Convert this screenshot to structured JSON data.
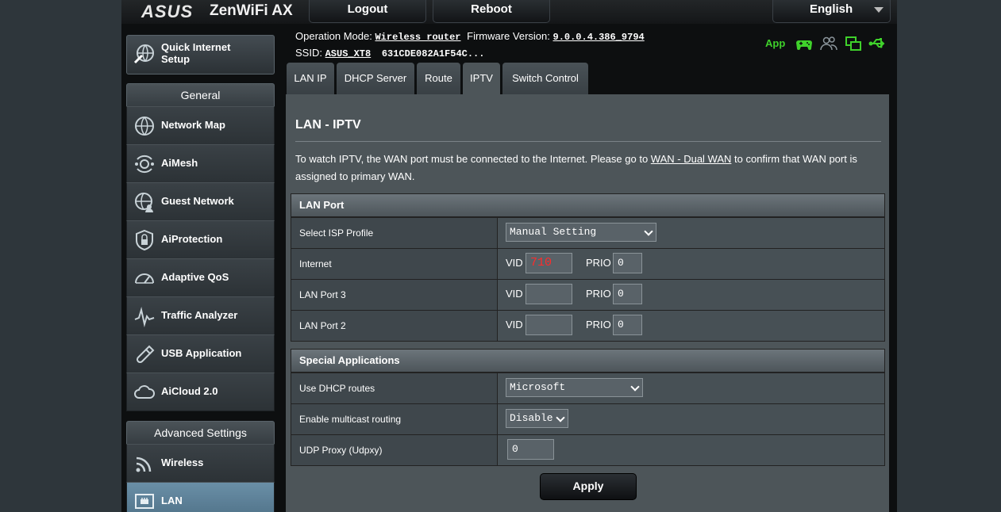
{
  "header": {
    "brand": "ASUS",
    "model": "ZenWiFi AX",
    "logout_label": "Logout",
    "reboot_label": "Reboot",
    "language": "English"
  },
  "status": {
    "operation_mode_label": "Operation Mode:",
    "operation_mode_value": "Wireless router",
    "firmware_label": "Firmware Version:",
    "firmware_value": "9.0.0.4.386_9794",
    "ssid_label": "SSID:",
    "ssid_value": "ASUS_XT8",
    "ssid_value2": "631CDE082A1F54C...",
    "app_label": "App",
    "icons": [
      "gamepad-icon",
      "users-icon",
      "devices-icon",
      "usb-icon"
    ],
    "accent_color": "#3fd12b"
  },
  "sidebar": {
    "quick_setup_label": "Quick Internet Setup",
    "general_label": "General",
    "general_items": [
      {
        "label": "Network Map",
        "icon": "globe-icon"
      },
      {
        "label": "AiMesh",
        "icon": "mesh-icon"
      },
      {
        "label": "Guest Network",
        "icon": "guest-globe-icon"
      },
      {
        "label": "AiProtection",
        "icon": "shield-lock-icon"
      },
      {
        "label": "Adaptive QoS",
        "icon": "gauge-icon"
      },
      {
        "label": "Traffic Analyzer",
        "icon": "traffic-chart-icon"
      },
      {
        "label": "USB Application",
        "icon": "usb-stick-icon"
      },
      {
        "label": "AiCloud 2.0",
        "icon": "cloud-icon"
      }
    ],
    "advanced_label": "Advanced Settings",
    "advanced_items": [
      {
        "label": "Wireless",
        "icon": "wifi-icon"
      },
      {
        "label": "LAN",
        "icon": "lan-icon"
      }
    ]
  },
  "tabs": [
    "LAN IP",
    "DHCP Server",
    "Route",
    "IPTV",
    "Switch Control"
  ],
  "active_tab": "IPTV",
  "page": {
    "title": "LAN - IPTV",
    "desc_prefix": "To watch IPTV, the WAN port must be connected to the Internet. Please go to ",
    "desc_link": "WAN - Dual WAN",
    "desc_suffix": " to confirm that WAN port is assigned to primary WAN."
  },
  "lan_port": {
    "header": "LAN Port",
    "isp_profile_label": "Select ISP Profile",
    "isp_profile_value": "Manual Setting",
    "vid_label": "VID",
    "prio_label": "PRIO",
    "rows": [
      {
        "label": "Internet",
        "vid": "710",
        "prio": "0"
      },
      {
        "label": "LAN Port 3",
        "vid": "",
        "prio": "0"
      },
      {
        "label": "LAN Port 2",
        "vid": "",
        "prio": "0"
      }
    ]
  },
  "special": {
    "header": "Special Applications",
    "dhcp_routes_label": "Use DHCP routes",
    "dhcp_routes_value": "Microsoft",
    "multicast_label": "Enable multicast routing",
    "multicast_value": "Disable",
    "udpxy_label": "UDP Proxy (Udpxy)",
    "udpxy_value": "0"
  },
  "apply_label": "Apply"
}
